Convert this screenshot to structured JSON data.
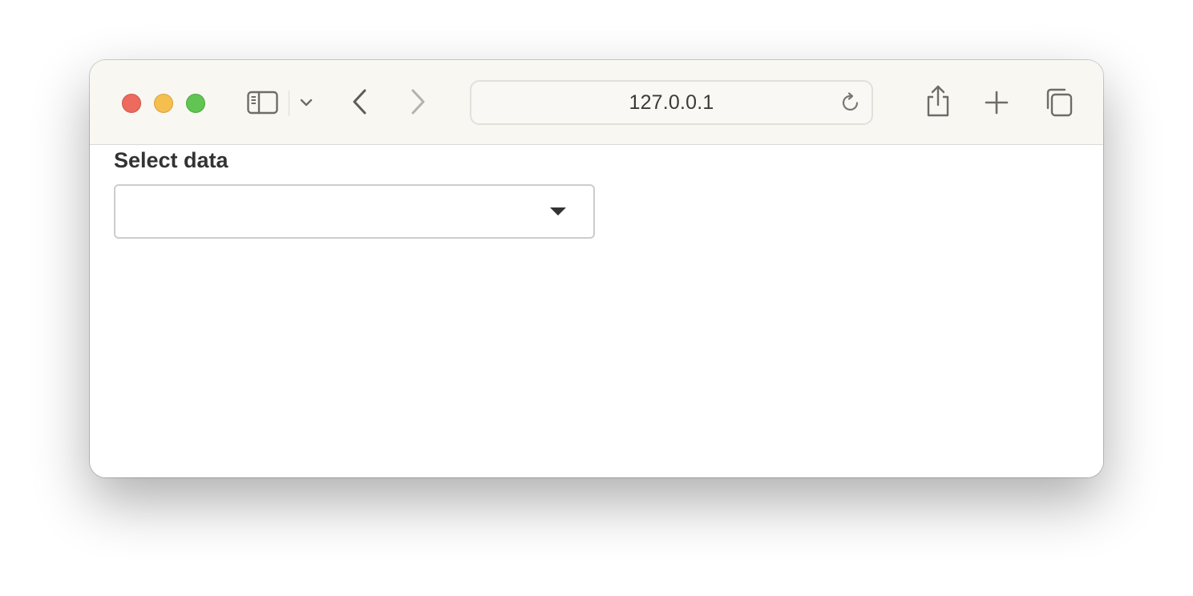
{
  "browser": {
    "address": "127.0.0.1",
    "controls": {
      "close": "close-button",
      "minimize": "minimize-button",
      "zoom": "zoom-button"
    },
    "icons": {
      "sidebar": "sidebar-icon",
      "tab_menu": "chevron-down-icon",
      "back": "chevron-left-icon",
      "forward": "chevron-right-icon",
      "reload": "reload-icon",
      "share": "share-icon",
      "new_tab": "plus-icon",
      "tab_overview": "tabs-icon"
    },
    "colors": {
      "toolbar_bg": "#f9f7f2",
      "close": "#ec6a5e",
      "minimize": "#f4bf4f",
      "zoom": "#61c554"
    }
  },
  "page": {
    "select": {
      "label": "Select data",
      "value": "",
      "icon": "caret-down-icon"
    }
  }
}
